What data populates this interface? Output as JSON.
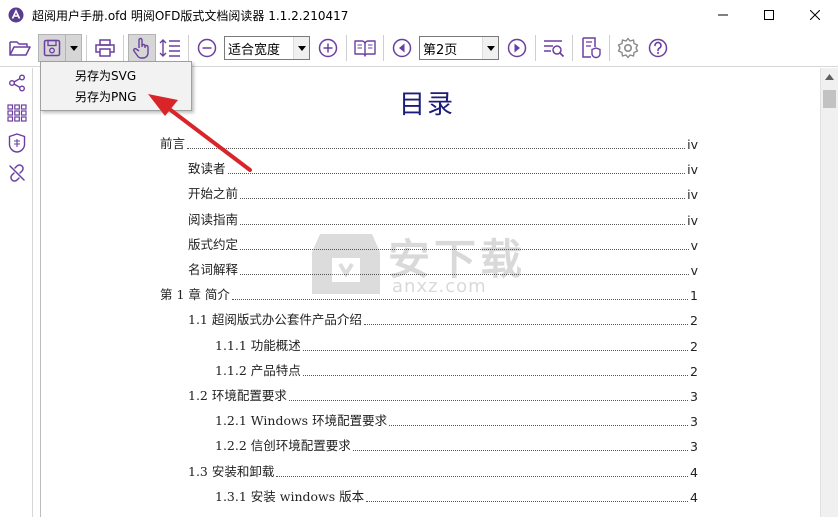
{
  "window": {
    "title": "超阅用户手册.ofd 明阅OFD版式文档阅读器 1.1.2.210417"
  },
  "toolbar": {
    "zoom_value": "适合宽度",
    "page_value": "第2页"
  },
  "menu": {
    "items": [
      "另存为SVG",
      "另存为PNG"
    ]
  },
  "document": {
    "title": "目录",
    "toc": [
      {
        "text": "前言",
        "page": "iv",
        "level": 0
      },
      {
        "text": "致读者",
        "page": "iv",
        "level": 1
      },
      {
        "text": "开始之前",
        "page": "iv",
        "level": 1
      },
      {
        "text": "阅读指南",
        "page": "iv",
        "level": 1
      },
      {
        "text": "版式约定",
        "page": "v",
        "level": 1
      },
      {
        "text": "名词解释",
        "page": "v",
        "level": 1
      },
      {
        "text": "第 1 章  简介",
        "page": "1",
        "level": 0
      },
      {
        "text": "1.1  超阅版式办公套件产品介绍",
        "page": "2",
        "level": 1
      },
      {
        "text": "1.1.1  功能概述",
        "page": "2",
        "level": 2
      },
      {
        "text": "1.1.2  产品特点",
        "page": "2",
        "level": 2
      },
      {
        "text": "1.2  环境配置要求",
        "page": "3",
        "level": 1
      },
      {
        "text": "1.2.1 Windows 环境配置要求",
        "page": "3",
        "level": 2
      },
      {
        "text": "1.2.2  信创环境配置要求",
        "page": "3",
        "level": 2
      },
      {
        "text": "1.3  安装和卸载",
        "page": "4",
        "level": 1
      },
      {
        "text": "1.3.1  安装 windows 版本",
        "page": "4",
        "level": 2
      }
    ]
  },
  "watermark": {
    "main": "安下载",
    "sub": "anxz.com"
  },
  "colors": {
    "icon_purple": "#6b3fa0",
    "title_blue": "#1c1c7a",
    "arrow_red": "#d9252a"
  }
}
